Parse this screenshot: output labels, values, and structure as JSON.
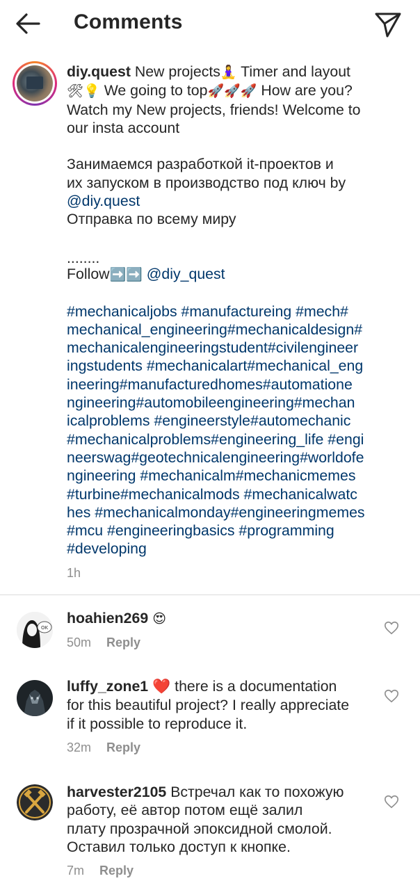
{
  "header": {
    "title": "Comments"
  },
  "caption": {
    "username": "diy.quest",
    "line1_text": "New projects",
    "line1_emoji": "🧘‍♀️",
    "line1_tail": " Timer and layout",
    "line2_emoji": "🛠💡",
    "line2_text": " We going to top",
    "line2_rockets": "🚀🚀🚀",
    "line2_tail": " How are you?",
    "line3": "Watch my New projects, friends! Welcome to",
    "line4": "our insta account",
    "ru1": "Занимаемся разработкой it-проектов и",
    "ru2": "их запуском в производство под ключ by",
    "ru_mention": "@diy.quest",
    "ru3": "Отправка по всему миру",
    "dots": "........",
    "follow_text": "Follow",
    "follow_arrows": "➡️➡️",
    "follow_mention": "@diy_quest",
    "hashtag_lines": [
      "#mechanicaljobs #manufactureing #mech#",
      "mechanical_engineering#mechanicaldesign#",
      "mechanicalengineeringstudent#civilengineer",
      "ingstudents #mechanicalart#mechanical_eng",
      "ineering#manufacturedhomes#automatione",
      "ngineering#automobileengineering#mechan",
      "icalproblems #engineerstyle#automechanic",
      "#mechanicalproblems#engineering_life #engi",
      "neerswag#geotechnicalengineering#worldofe",
      "ngineering #mechanicalm#mechanicmemes",
      "#turbine#mechanicalmods  #mechanicalwatc",
      "hes #mechanicalmonday#engineeringmemes",
      "#mcu #engineeringbasics #programming",
      "#developing"
    ],
    "timestamp": "1h"
  },
  "comments": [
    {
      "username": "hoahien269",
      "lines": [
        " 😍"
      ],
      "time": "50m",
      "reply_label": "Reply"
    },
    {
      "username": "luffy_zone1",
      "first_emoji": "❤️",
      "lines": [
        " there is a documentation",
        "for this beautiful project? I really appreciate",
        "if it possible to reproduce it."
      ],
      "time": "32m",
      "reply_label": "Reply"
    },
    {
      "username": "harvester2105",
      "lines": [
        " Встречал как то похожую",
        "работу, её автор потом ещё залил",
        "плату прозрачной эпоксидной смолой.",
        "Оставил только доступ к кнопке."
      ],
      "time": "7m",
      "reply_label": "Reply"
    }
  ],
  "colors": {
    "link": "#00376b",
    "text": "#262626",
    "muted": "#8e8e8e",
    "divider": "#dbdbdb"
  },
  "icons": {
    "back": "arrow-left-icon",
    "share": "paper-plane-icon",
    "like": "heart-outline-icon"
  }
}
